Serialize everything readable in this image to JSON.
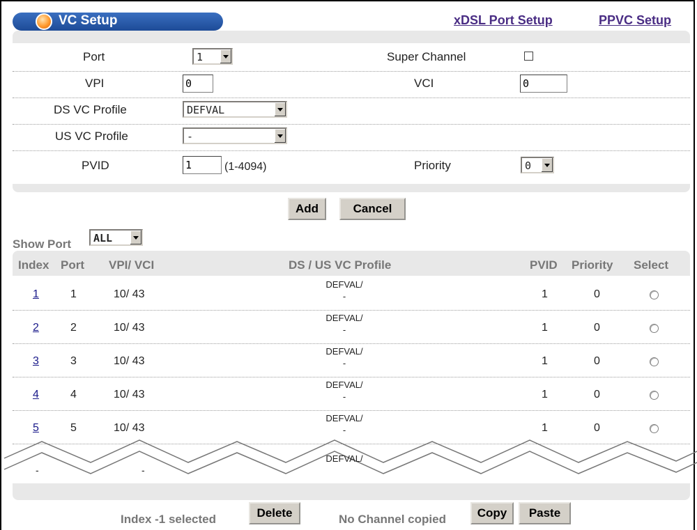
{
  "header": {
    "title": "VC Setup",
    "links": [
      "xDSL Port Setup",
      "PPVC Setup"
    ]
  },
  "form": {
    "port_label": "Port",
    "port_value": "1",
    "super_channel_label": "Super Channel",
    "vpi_label": "VPI",
    "vpi_value": "0",
    "vci_label": "VCI",
    "vci_value": "0",
    "ds_profile_label": "DS VC Profile",
    "ds_profile_value": "DEFVAL",
    "us_profile_label": "US VC Profile",
    "us_profile_value": "-",
    "pvid_label": "PVID",
    "pvid_value": "1",
    "pvid_range": "(1-4094)",
    "priority_label": "Priority",
    "priority_value": "0",
    "add_label": "Add",
    "cancel_label": "Cancel"
  },
  "show_port": {
    "label": "Show Port",
    "value": "ALL"
  },
  "table": {
    "headers": [
      "Index",
      "Port",
      "VPI/ VCI",
      "DS / US VC Profile",
      "PVID",
      "Priority",
      "Select"
    ],
    "rows": [
      {
        "index": "1",
        "port": "1",
        "vpi_vci": "10/ 43",
        "ds": "DEFVAL/",
        "us": "-",
        "pvid": "1",
        "priority": "0"
      },
      {
        "index": "2",
        "port": "2",
        "vpi_vci": "10/ 43",
        "ds": "DEFVAL/",
        "us": "-",
        "pvid": "1",
        "priority": "0"
      },
      {
        "index": "3",
        "port": "3",
        "vpi_vci": "10/ 43",
        "ds": "DEFVAL/",
        "us": "-",
        "pvid": "1",
        "priority": "0"
      },
      {
        "index": "4",
        "port": "4",
        "vpi_vci": "10/ 43",
        "ds": "DEFVAL/",
        "us": "-",
        "pvid": "1",
        "priority": "0"
      },
      {
        "index": "5",
        "port": "5",
        "vpi_vci": "10/ 43",
        "ds": "DEFVAL/",
        "us": "-",
        "pvid": "1",
        "priority": "0"
      }
    ],
    "cut_row": {
      "index": "-",
      "port": "-",
      "ds": "DEFVAL/"
    }
  },
  "footer": {
    "index_selected": "Index -1 selected",
    "delete_label": "Delete",
    "no_channel": "No Channel copied",
    "copy_label": "Copy",
    "paste_label": "Paste"
  }
}
